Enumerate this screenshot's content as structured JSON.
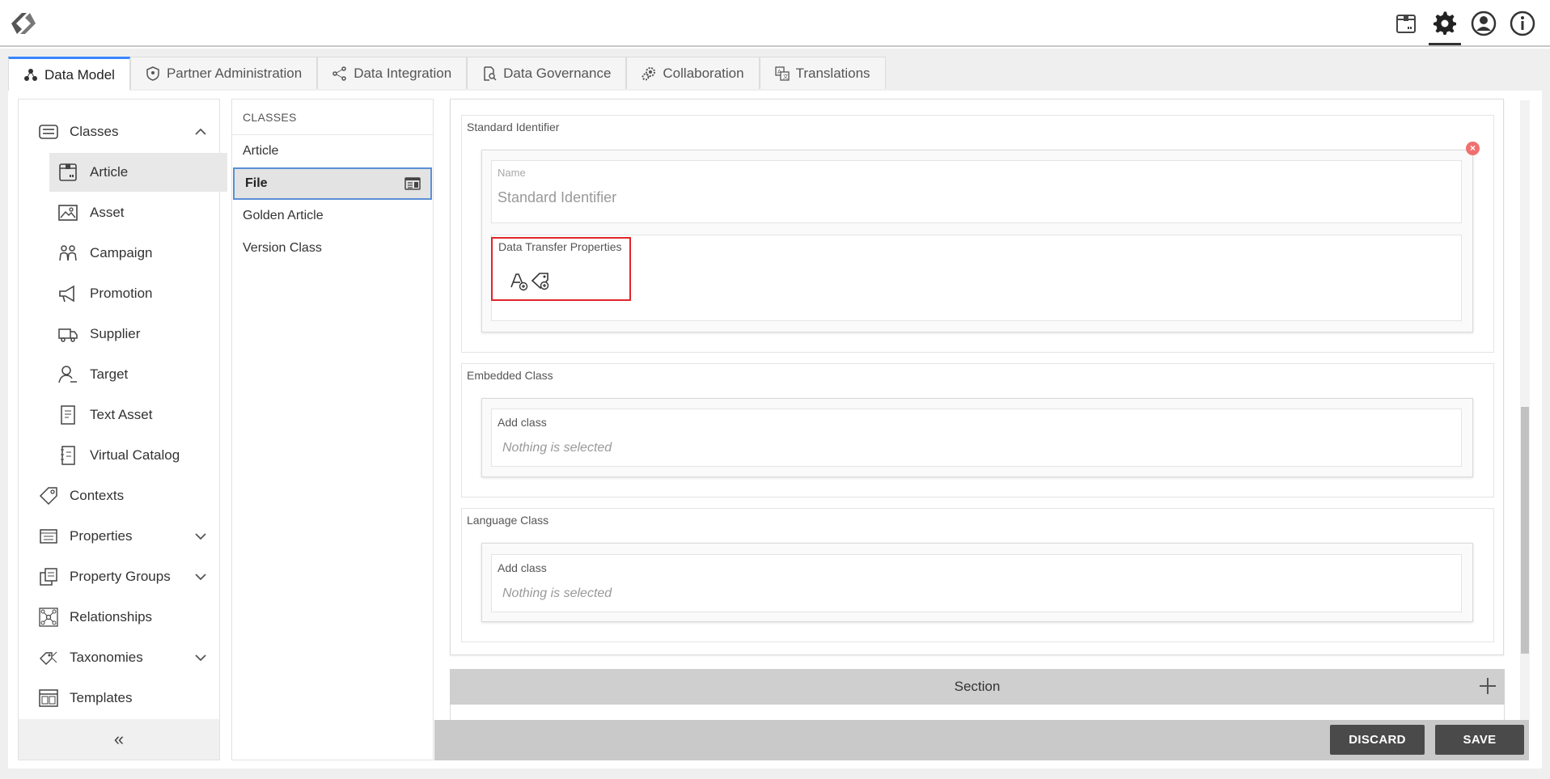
{
  "header": {
    "icons": [
      "logo-icon",
      "package-icon",
      "gear-icon",
      "user-circle-icon",
      "info-icon"
    ]
  },
  "tabs": [
    {
      "label": "Data Model",
      "icon": "data-model-icon",
      "active": true
    },
    {
      "label": "Partner Administration",
      "icon": "shield-icon",
      "active": false
    },
    {
      "label": "Data Integration",
      "icon": "share-nodes-icon",
      "active": false
    },
    {
      "label": "Data Governance",
      "icon": "document-search-icon",
      "active": false
    },
    {
      "label": "Collaboration",
      "icon": "gears-icon",
      "active": false
    },
    {
      "label": "Translations",
      "icon": "translate-icon",
      "active": false
    }
  ],
  "sidebar": {
    "items": [
      {
        "label": "Classes",
        "icon": "classes-icon"
      },
      {
        "label": "Article",
        "icon": "article-icon"
      },
      {
        "label": "Asset",
        "icon": "image-icon"
      },
      {
        "label": "Campaign",
        "icon": "campaign-icon"
      },
      {
        "label": "Promotion",
        "icon": "megaphone-icon"
      },
      {
        "label": "Supplier",
        "icon": "truck-icon"
      },
      {
        "label": "Target",
        "icon": "target-user-icon"
      },
      {
        "label": "Text Asset",
        "icon": "text-document-icon"
      },
      {
        "label": "Virtual Catalog",
        "icon": "catalog-icon"
      },
      {
        "label": "Contexts",
        "icon": "tag-icon"
      },
      {
        "label": "Properties",
        "icon": "properties-icon"
      },
      {
        "label": "Property Groups",
        "icon": "property-groups-icon"
      },
      {
        "label": "Relationships",
        "icon": "relationships-icon"
      },
      {
        "label": "Taxonomies",
        "icon": "taxonomy-icon"
      },
      {
        "label": "Templates",
        "icon": "templates-icon"
      }
    ],
    "collapse_label": "«"
  },
  "classes_panel": {
    "header": "CLASSES",
    "items": [
      "Article",
      "File",
      "Golden Article",
      "Version Class"
    ],
    "selected": "File"
  },
  "detail": {
    "standard_identifier": {
      "group_label": "Standard Identifier",
      "name_label": "Name",
      "name_value": "Standard Identifier",
      "dtp_label": "Data Transfer Properties"
    },
    "embedded_class": {
      "group_label": "Embedded Class",
      "add_label": "Add class",
      "placeholder": "Nothing is selected"
    },
    "language_class": {
      "group_label": "Language Class",
      "add_label": "Add class",
      "placeholder": "Nothing is selected"
    },
    "section_label": "Section"
  },
  "footer": {
    "discard_label": "DISCARD",
    "save_label": "SAVE"
  }
}
